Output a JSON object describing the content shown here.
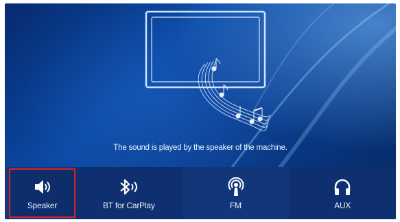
{
  "screen": {
    "caption": "The sound is played by the speaker of the machine."
  },
  "audio_outputs": [
    {
      "label": "Speaker",
      "icon": "speaker-icon",
      "selected": true
    },
    {
      "label": "BT for CarPlay",
      "icon": "bluetooth-audio-icon",
      "selected": false
    },
    {
      "label": "FM",
      "icon": "fm-radio-icon",
      "selected": false
    },
    {
      "label": "AUX",
      "icon": "headphones-icon",
      "selected": false
    }
  ],
  "colors": {
    "selection_border": "#e02222",
    "text": "#e8f1ff",
    "background": "#0b4aa6"
  }
}
